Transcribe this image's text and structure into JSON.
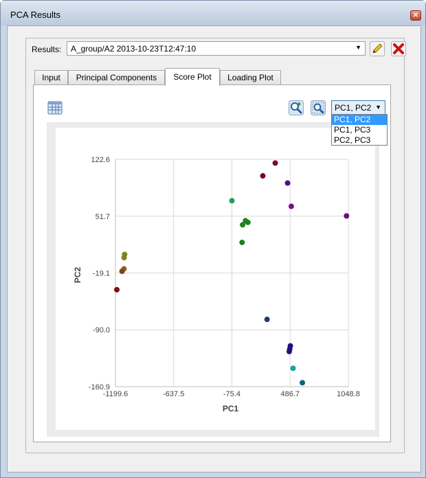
{
  "window": {
    "title": "PCA Results",
    "close_icon": "close-icon"
  },
  "results": {
    "label": "Results:",
    "value": "A_group/A2 2013-10-23T12:47:10",
    "edit_icon": "pencil-icon",
    "delete_icon": "delete-x-icon"
  },
  "tabs": [
    {
      "label": "Input",
      "active": false
    },
    {
      "label": "Principal Components",
      "active": false
    },
    {
      "label": "Score Plot",
      "active": true
    },
    {
      "label": "Loading Plot",
      "active": false
    }
  ],
  "toolbar": {
    "table_icon": "table-icon",
    "zoom_in_icon": "zoom-in-icon",
    "zoom_fit_icon": "zoom-fit-icon"
  },
  "pc_select": {
    "value": "PC1, PC2",
    "options": [
      "PC1, PC2",
      "PC1, PC3",
      "PC2, PC3"
    ],
    "selected_index": 0
  },
  "chart_data": {
    "type": "scatter",
    "xlabel": "PC1",
    "ylabel": "PC2",
    "xlim": [
      -1199.6,
      1048.8
    ],
    "ylim": [
      -160.9,
      122.6
    ],
    "xticks": [
      -1199.6,
      -637.5,
      -75.4,
      486.7,
      1048.8
    ],
    "xtick_labels": [
      "-1199.6",
      "-637.5",
      "-75.4",
      "486.7",
      "1048.8"
    ],
    "yticks": [
      122.6,
      51.7,
      -19.1,
      -90.0,
      -160.9
    ],
    "ytick_labels": [
      "122.6",
      "51.7",
      "-19.1",
      "-90.0",
      "-160.9"
    ],
    "grid": true,
    "points": [
      {
        "x": 343,
        "y": 118,
        "color": "#800040"
      },
      {
        "x": 223,
        "y": 102,
        "color": "#800020"
      },
      {
        "x": 462,
        "y": 93,
        "color": "#4a1080"
      },
      {
        "x": 498,
        "y": 64,
        "color": "#7a1080"
      },
      {
        "x": 1031,
        "y": 52,
        "color": "#6a1080"
      },
      {
        "x": -75,
        "y": 71,
        "color": "#20a060"
      },
      {
        "x": 56,
        "y": 46,
        "color": "#208020"
      },
      {
        "x": 79,
        "y": 44,
        "color": "#208020"
      },
      {
        "x": 28,
        "y": 41,
        "color": "#208020"
      },
      {
        "x": 23,
        "y": 19,
        "color": "#208020"
      },
      {
        "x": -1111,
        "y": 4,
        "color": "#808020"
      },
      {
        "x": -1116,
        "y": 0,
        "color": "#808020"
      },
      {
        "x": -1117,
        "y": -14,
        "color": "#906020"
      },
      {
        "x": -1136,
        "y": -17,
        "color": "#804020"
      },
      {
        "x": -1186,
        "y": -40,
        "color": "#801010"
      },
      {
        "x": 264,
        "y": -77,
        "color": "#203a80"
      },
      {
        "x": 489,
        "y": -110,
        "color": "#201080"
      },
      {
        "x": 483,
        "y": -114,
        "color": "#201080"
      },
      {
        "x": 478,
        "y": -117,
        "color": "#201080"
      },
      {
        "x": 515,
        "y": -138,
        "color": "#20a0a0"
      },
      {
        "x": 605,
        "y": -156,
        "color": "#106080"
      }
    ]
  }
}
